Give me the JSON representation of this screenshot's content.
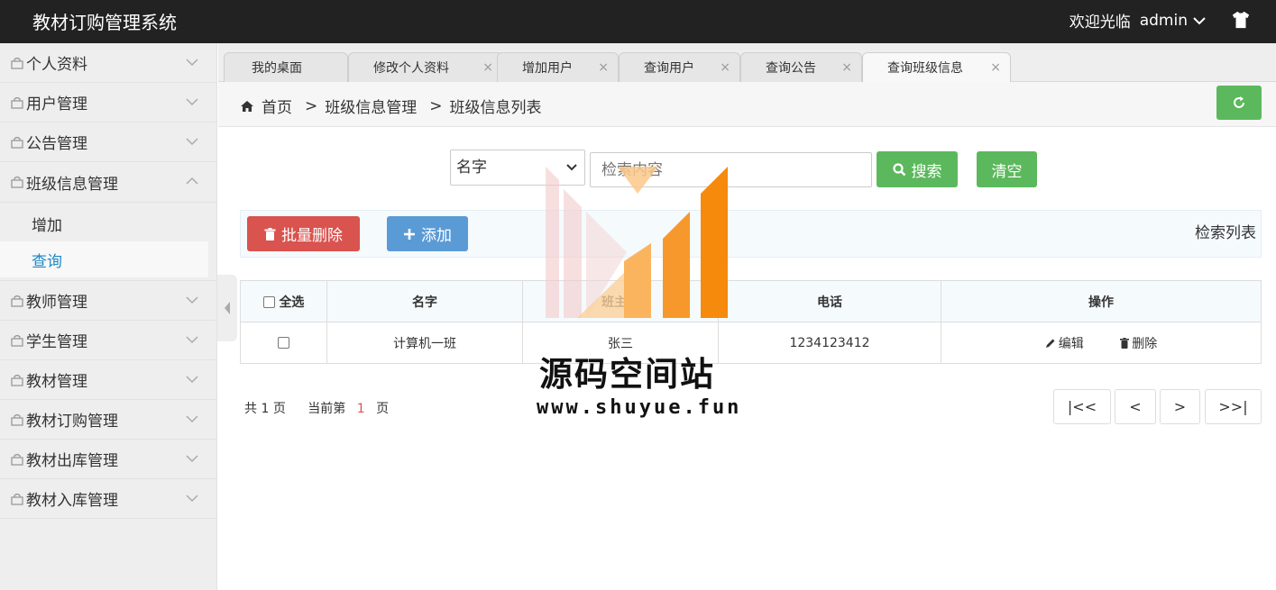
{
  "app": {
    "title": "教材订购管理系统",
    "welcome": "欢迎光临",
    "user": "admin"
  },
  "sidebar": {
    "items": [
      {
        "label": "个人资料"
      },
      {
        "label": "用户管理"
      },
      {
        "label": "公告管理"
      },
      {
        "label": "班级信息管理"
      },
      {
        "label": "教师管理"
      },
      {
        "label": "学生管理"
      },
      {
        "label": "教材管理"
      },
      {
        "label": "教材订购管理"
      },
      {
        "label": "教材出库管理"
      },
      {
        "label": "教材入库管理"
      }
    ],
    "sub_items": [
      {
        "label": "增加"
      },
      {
        "label": "查询"
      }
    ]
  },
  "tabs": [
    {
      "label": "我的桌面"
    },
    {
      "label": "修改个人资料"
    },
    {
      "label": "增加用户"
    },
    {
      "label": "查询用户"
    },
    {
      "label": "查询公告"
    },
    {
      "label": "查询班级信息"
    }
  ],
  "tab_close": "×",
  "breadcrumb": {
    "home": "首页",
    "sep": ">",
    "level1": "班级信息管理",
    "level2": "班级信息列表"
  },
  "search": {
    "field": "名字",
    "placeholder": "检索内容",
    "search_label": "搜索",
    "clear_label": "清空"
  },
  "actions": {
    "batch_delete": "批量删除",
    "add": "添加",
    "list_title": "检索列表"
  },
  "table": {
    "headers": {
      "select_all": "全选",
      "name": "名字",
      "teacher": "班主任",
      "phone": "电话",
      "ops": "操作"
    },
    "rows": [
      {
        "name": "计算机一班",
        "teacher": "张三",
        "phone": "1234123412",
        "edit": "编辑",
        "delete": "删除"
      }
    ]
  },
  "pager": {
    "total_prefix": "共",
    "total": "1",
    "page_unit": "页",
    "current_prefix": "当前第",
    "current": "1",
    "first": "|<<",
    "prev": "<",
    "next": ">",
    "last": ">>|"
  },
  "watermark": {
    "title": "源码空间站",
    "url": "www.shuyue.fun"
  },
  "colors": {
    "topbar": "#222222",
    "success": "#5cb85c",
    "danger": "#d9534f",
    "primary": "#5b9bd5",
    "active_link": "#1e88c8"
  }
}
